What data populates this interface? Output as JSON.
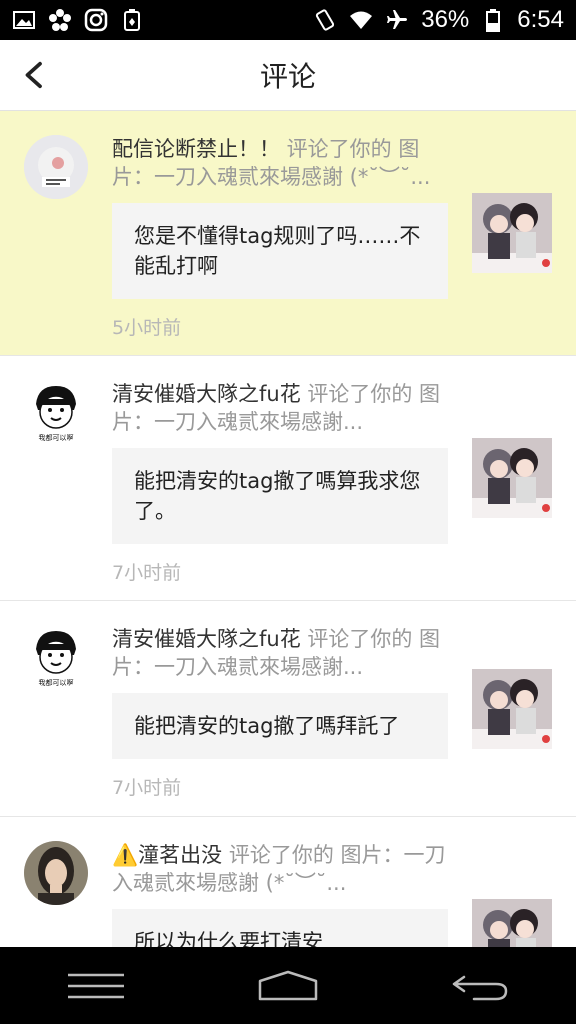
{
  "status_bar": {
    "battery": "36%",
    "time": "6:54",
    "icons_left": [
      "gallery-icon",
      "flower-icon",
      "instagram-icon",
      "battery-saver-icon"
    ],
    "icons_right": [
      "vibrate-icon",
      "wifi-icon",
      "airplane-icon",
      "battery-icon"
    ]
  },
  "header": {
    "title": "评论"
  },
  "notifications": [
    {
      "user": "配信论断禁止！！",
      "action": " 评论了你的 图片：一刀入魂贰來場感謝 (*˘︶˘...",
      "comment": "您是不懂得tag规则了吗……不能乱打啊",
      "time": "5小时前",
      "unread": true
    },
    {
      "user": "清安催婚大隊之fu花",
      "action": " 评论了你的 图片：一刀入魂贰來場感謝...",
      "comment": "能把清安的tag撤了嗎算我求您了。",
      "time": "7小时前",
      "unread": false
    },
    {
      "user": "清安催婚大隊之fu花",
      "action": " 评论了你的 图片：一刀入魂贰來場感謝...",
      "comment": "能把清安的tag撤了嗎拜託了",
      "time": "7小时前",
      "unread": false
    },
    {
      "user": "⚠️潼茗出没",
      "action": " 评论了你的 图片：一刀入魂贰來場感謝 (*˘︶˘...",
      "comment": "所以为什么要打清安",
      "time": "",
      "unread": false
    }
  ],
  "avatar_caption": "我都可以啊",
  "colors": {
    "unread_bg": "#f8f8c8",
    "status_bar": "#000000",
    "comment_box": "#f4f4f4",
    "muted_text": "#999999"
  }
}
